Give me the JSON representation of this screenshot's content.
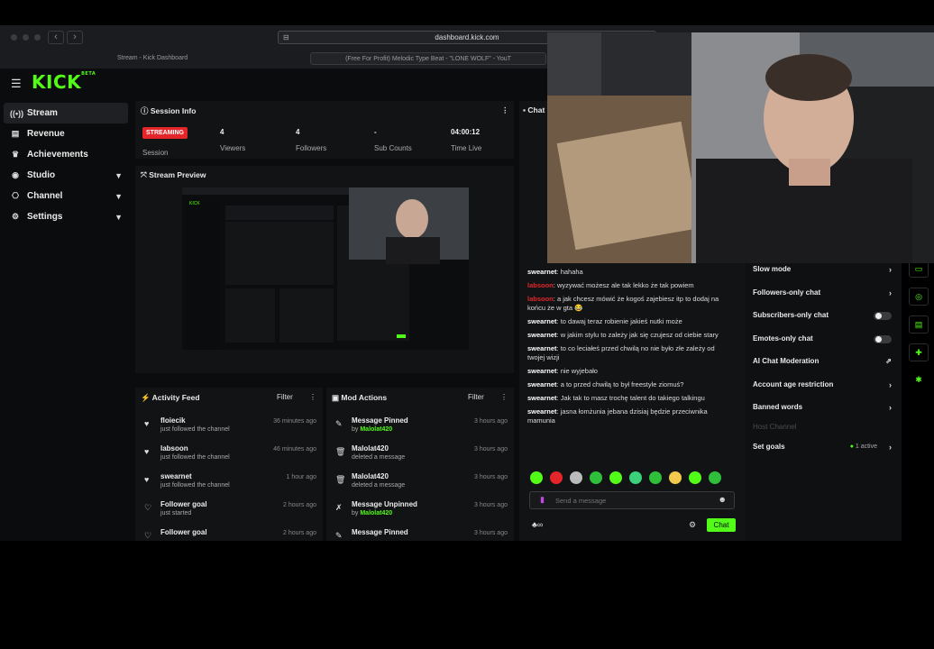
{
  "browser": {
    "url": "dashboard.kick.com",
    "tabs": [
      "Stream - Kick Dashboard",
      "(Free For Profit) Melodic Type Beat - \"LONE WOLF\" - YouT"
    ]
  },
  "logo": {
    "text": "KICK",
    "sup": "BETA"
  },
  "colors": {
    "accent": "#53fc18",
    "live": "#e4262a",
    "bg": "#0b0c0d"
  },
  "sidebar": {
    "items": [
      {
        "label": "Stream",
        "icon": "broadcast-icon",
        "active": true
      },
      {
        "label": "Revenue",
        "icon": "wallet-icon"
      },
      {
        "label": "Achievements",
        "icon": "trophy-icon"
      },
      {
        "label": "Studio",
        "icon": "studio-icon",
        "expandable": true
      },
      {
        "label": "Channel",
        "icon": "channel-icon",
        "expandable": true
      },
      {
        "label": "Settings",
        "icon": "gear-icon",
        "expandable": true
      }
    ]
  },
  "session": {
    "title": "Session Info",
    "badge": "STREAMING",
    "badge_label": "Session",
    "stats": [
      {
        "value": "4",
        "label": "Viewers"
      },
      {
        "value": "4",
        "label": "Followers"
      },
      {
        "value": "-",
        "label": "Sub Counts"
      },
      {
        "value": "04:00:12",
        "label": "Time Live"
      }
    ]
  },
  "preview": {
    "title": "Stream Preview"
  },
  "activity": {
    "title": "Activity Feed",
    "filter": "Filter",
    "items": [
      {
        "name": "floiecik",
        "sub": "just followed the channel",
        "time": "36 minutes ago"
      },
      {
        "name": "labsoon",
        "sub": "just followed the channel",
        "time": "46 minutes ago"
      },
      {
        "name": "swearnet",
        "sub": "just followed the channel",
        "time": "1 hour ago"
      },
      {
        "name": "Follower goal",
        "sub": "just started",
        "time": "2 hours ago"
      },
      {
        "name": "Follower goal",
        "sub": "",
        "time": "2 hours ago"
      }
    ]
  },
  "mod_actions": {
    "title": "Mod Actions",
    "filter": "Filter",
    "items": [
      {
        "name": "Message Pinned",
        "by": "by ",
        "user": "Malolat420",
        "time": "3 hours ago"
      },
      {
        "name": "Malolat420",
        "by": "deleted a message",
        "user": "",
        "time": "3 hours ago"
      },
      {
        "name": "Malolat420",
        "by": "deleted a message",
        "user": "",
        "time": "3 hours ago"
      },
      {
        "name": "Message Unpinned",
        "by": "by ",
        "user": "Malolat420",
        "time": "3 hours ago"
      },
      {
        "name": "Message Pinned",
        "by": "",
        "user": "",
        "time": "3 hours ago"
      }
    ]
  },
  "chat": {
    "title": "Chat",
    "messages": [
      {
        "user": "swearnet",
        "text": "hahaha"
      },
      {
        "user": "labsoon",
        "text": "wyzywać możesz ale tak lekko że tak powiem",
        "red": true
      },
      {
        "user": "labsoon",
        "text": "a jak chcesz mówić że kogoś zajebiesz itp to dodaj na końcu że w gta 😂",
        "red": true
      },
      {
        "user": "swearnet",
        "text": "to dawaj teraz robienie jakieś nutki może"
      },
      {
        "user": "swearnet",
        "text": "w jakim stylu to zależy jak się czujesz od ciebie stary"
      },
      {
        "user": "swearnet",
        "text": "to co leciałeś przed chwilą no nie było złe zależy od twojej wizji"
      },
      {
        "user": "swearnet",
        "text": "nie wyjebało"
      },
      {
        "user": "swearnet",
        "text": "a to przed chwilą to był freestyle ziomuś?"
      },
      {
        "user": "swearnet",
        "text": "Jak tak to masz trochę talent do takiego talkingu"
      },
      {
        "user": "swearnet",
        "text": "jasna łomżunia jebana dzisiaj będzie przeciwnika mamunia"
      }
    ],
    "input_placeholder": "Send a message",
    "send": "Chat"
  },
  "chat_settings": {
    "items": [
      {
        "label": "Slow mode",
        "kind": "chevron"
      },
      {
        "label": "Followers-only chat",
        "kind": "chevron"
      },
      {
        "label": "Subscribers-only chat",
        "kind": "toggle"
      },
      {
        "label": "Emotes-only chat",
        "kind": "toggle"
      },
      {
        "label": "AI Chat Moderation",
        "kind": "external"
      },
      {
        "label": "Account age restriction",
        "kind": "chevron"
      },
      {
        "label": "Banned words",
        "kind": "chevron"
      },
      {
        "label": "Host Channel",
        "kind": "disabled"
      },
      {
        "label": "Set goals",
        "kind": "goals",
        "extra": "1 active"
      }
    ]
  }
}
